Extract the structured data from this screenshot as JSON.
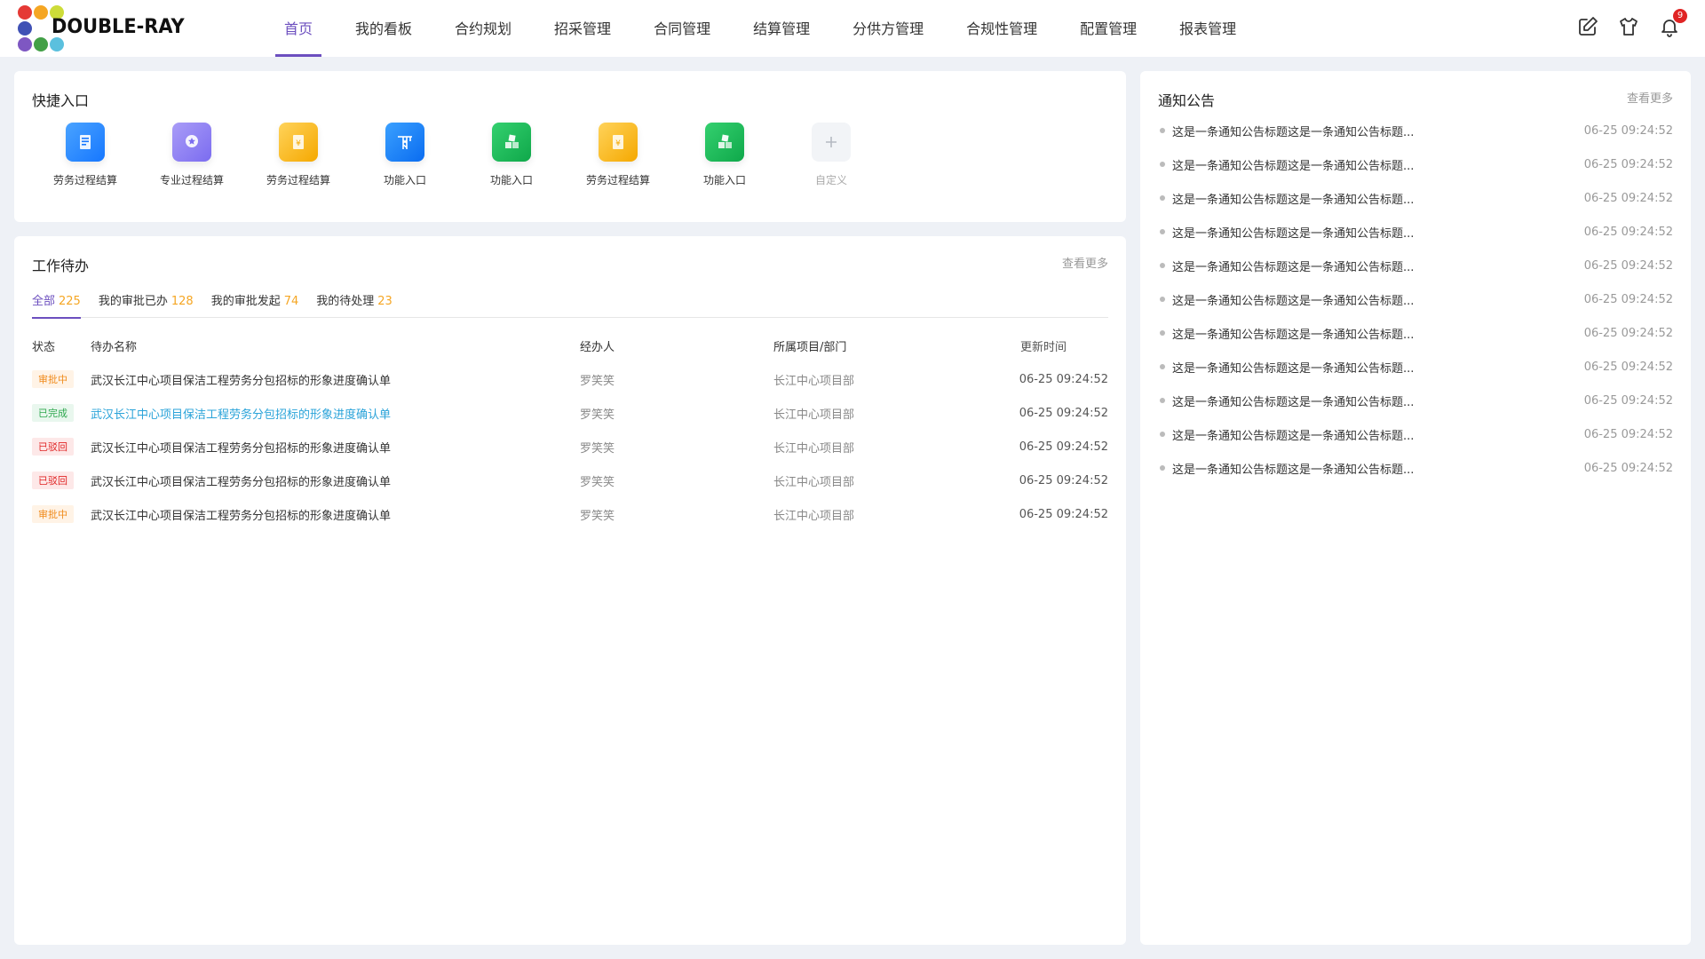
{
  "brand": {
    "name": "DOUBLE-RAY",
    "dot_colors": [
      "#e53935",
      "#f5a623",
      "#cddc39",
      "#3f51b5",
      "#ffffff",
      "#ffffff",
      "#7e57c2",
      "#43a047",
      "#5bc0de"
    ]
  },
  "nav": [
    "首页",
    "我的看板",
    "合约规划",
    "招采管理",
    "合同管理",
    "结算管理",
    "分供方管理",
    "合规性管理",
    "配置管理",
    "报表管理"
  ],
  "header_icons": {
    "edit": "edit-icon",
    "shirt": "shirt-icon",
    "bell": "bell-icon",
    "notification_count": "9"
  },
  "quick": {
    "title": "快捷入口",
    "items": [
      {
        "label": "劳务过程结算",
        "icon": "document-icon",
        "color": "#2f8cf0"
      },
      {
        "label": "专业过程结算",
        "icon": "medal-icon",
        "color": "#8a7cf0"
      },
      {
        "label": "劳务过程结算",
        "icon": "yuan-doc-icon",
        "color": "#f5b400"
      },
      {
        "label": "功能入口",
        "icon": "crane-icon",
        "color": "#1e90ff"
      },
      {
        "label": "功能入口",
        "icon": "cubes-icon",
        "color": "#1bc15a"
      },
      {
        "label": "劳务过程结算",
        "icon": "yuan-doc-icon",
        "color": "#f5b400"
      },
      {
        "label": "功能入口",
        "icon": "cubes-icon",
        "color": "#1bc15a"
      },
      {
        "label": "自定义",
        "icon": "plus-icon",
        "color": "#f2f4f7"
      }
    ]
  },
  "tasks": {
    "title": "工作待办",
    "more": "查看更多",
    "tabs": [
      {
        "label": "全部",
        "count": "225"
      },
      {
        "label": "我的审批已办",
        "count": "128"
      },
      {
        "label": "我的审批发起",
        "count": "74"
      },
      {
        "label": "我的待处理",
        "count": "23"
      }
    ],
    "columns": [
      "状态",
      "待办名称",
      "经办人",
      "所属项目/部门",
      "更新时间"
    ],
    "rows": [
      {
        "status": "审批中",
        "name": "武汉长江中心项目保洁工程劳务分包招标的形象进度确认单",
        "owner": "罗笑笑",
        "dept": "长江中心项目部",
        "time": "06-25 09:24:52"
      },
      {
        "status": "已完成",
        "name": "武汉长江中心项目保洁工程劳务分包招标的形象进度确认单",
        "owner": "罗笑笑",
        "dept": "长江中心项目部",
        "time": "06-25 09:24:52"
      },
      {
        "status": "已驳回",
        "name": "武汉长江中心项目保洁工程劳务分包招标的形象进度确认单",
        "owner": "罗笑笑",
        "dept": "长江中心项目部",
        "time": "06-25 09:24:52"
      },
      {
        "status": "已驳回",
        "name": "武汉长江中心项目保洁工程劳务分包招标的形象进度确认单",
        "owner": "罗笑笑",
        "dept": "长江中心项目部",
        "time": "06-25 09:24:52"
      },
      {
        "status": "审批中",
        "name": "武汉长江中心项目保洁工程劳务分包招标的形象进度确认单",
        "owner": "罗笑笑",
        "dept": "长江中心项目部",
        "time": "06-25 09:24:52"
      }
    ]
  },
  "notices": {
    "title": "通知公告",
    "more": "查看更多",
    "items": [
      {
        "title": "这是一条通知公告标题这是一条通知公告标题...",
        "time": "06-25 09:24:52"
      },
      {
        "title": "这是一条通知公告标题这是一条通知公告标题...",
        "time": "06-25 09:24:52"
      },
      {
        "title": "这是一条通知公告标题这是一条通知公告标题...",
        "time": "06-25 09:24:52"
      },
      {
        "title": "这是一条通知公告标题这是一条通知公告标题...",
        "time": "06-25 09:24:52"
      },
      {
        "title": "这是一条通知公告标题这是一条通知公告标题...",
        "time": "06-25 09:24:52"
      },
      {
        "title": "这是一条通知公告标题这是一条通知公告标题...",
        "time": "06-25 09:24:52"
      },
      {
        "title": "这是一条通知公告标题这是一条通知公告标题...",
        "time": "06-25 09:24:52"
      },
      {
        "title": "这是一条通知公告标题这是一条通知公告标题...",
        "time": "06-25 09:24:52"
      },
      {
        "title": "这是一条通知公告标题这是一条通知公告标题...",
        "time": "06-25 09:24:52"
      },
      {
        "title": "这是一条通知公告标题这是一条通知公告标题...",
        "time": "06-25 09:24:52"
      },
      {
        "title": "这是一条通知公告标题这是一条通知公告标题...",
        "time": "06-25 09:24:52"
      }
    ]
  }
}
